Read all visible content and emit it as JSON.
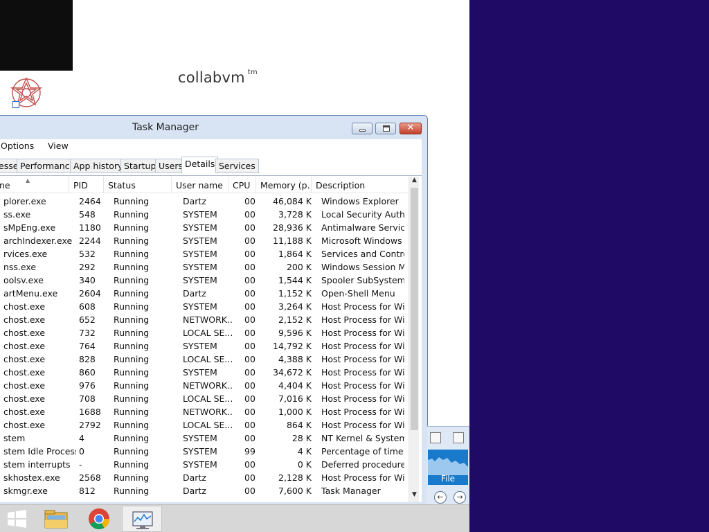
{
  "desktop": {
    "brand": "collabvm",
    "brand_sup": "tm"
  },
  "window": {
    "title": "Task Manager",
    "menu": [
      "Options",
      "View"
    ],
    "tabs": [
      "esses",
      "Performance",
      "App history",
      "Startup",
      "Users",
      "Details",
      "Services"
    ],
    "active_tab": "Details"
  },
  "columns": [
    "ne",
    "PID",
    "Status",
    "User name",
    "CPU",
    "Memory (p...",
    "Description"
  ],
  "rows": [
    {
      "name": "plorer.exe",
      "pid": "2464",
      "status": "Running",
      "user": "Dartz",
      "cpu": "00",
      "mem": "46,084 K",
      "desc": "Windows Explorer"
    },
    {
      "name": "ss.exe",
      "pid": "548",
      "status": "Running",
      "user": "SYSTEM",
      "cpu": "00",
      "mem": "3,728 K",
      "desc": "Local Security Auth..."
    },
    {
      "name": "sMpEng.exe",
      "pid": "1180",
      "status": "Running",
      "user": "SYSTEM",
      "cpu": "00",
      "mem": "28,936 K",
      "desc": "Antimalware Service..."
    },
    {
      "name": "archIndexer.exe",
      "pid": "2244",
      "status": "Running",
      "user": "SYSTEM",
      "cpu": "00",
      "mem": "11,188 K",
      "desc": "Microsoft Windows ..."
    },
    {
      "name": "rvices.exe",
      "pid": "532",
      "status": "Running",
      "user": "SYSTEM",
      "cpu": "00",
      "mem": "1,864 K",
      "desc": "Services and Control..."
    },
    {
      "name": "nss.exe",
      "pid": "292",
      "status": "Running",
      "user": "SYSTEM",
      "cpu": "00",
      "mem": "200 K",
      "desc": "Windows Session M..."
    },
    {
      "name": "oolsv.exe",
      "pid": "340",
      "status": "Running",
      "user": "SYSTEM",
      "cpu": "00",
      "mem": "1,544 K",
      "desc": "Spooler SubSystem ..."
    },
    {
      "name": "artMenu.exe",
      "pid": "2604",
      "status": "Running",
      "user": "Dartz",
      "cpu": "00",
      "mem": "1,152 K",
      "desc": "Open-Shell Menu"
    },
    {
      "name": "chost.exe",
      "pid": "608",
      "status": "Running",
      "user": "SYSTEM",
      "cpu": "00",
      "mem": "3,264 K",
      "desc": "Host Process for Wi..."
    },
    {
      "name": "chost.exe",
      "pid": "652",
      "status": "Running",
      "user": "NETWORK...",
      "cpu": "00",
      "mem": "2,152 K",
      "desc": "Host Process for Wi..."
    },
    {
      "name": "chost.exe",
      "pid": "732",
      "status": "Running",
      "user": "LOCAL SE...",
      "cpu": "00",
      "mem": "9,596 K",
      "desc": "Host Process for Wi..."
    },
    {
      "name": "chost.exe",
      "pid": "764",
      "status": "Running",
      "user": "SYSTEM",
      "cpu": "00",
      "mem": "14,792 K",
      "desc": "Host Process for Wi..."
    },
    {
      "name": "chost.exe",
      "pid": "828",
      "status": "Running",
      "user": "LOCAL SE...",
      "cpu": "00",
      "mem": "4,388 K",
      "desc": "Host Process for Wi..."
    },
    {
      "name": "chost.exe",
      "pid": "860",
      "status": "Running",
      "user": "SYSTEM",
      "cpu": "00",
      "mem": "34,672 K",
      "desc": "Host Process for Wi..."
    },
    {
      "name": "chost.exe",
      "pid": "976",
      "status": "Running",
      "user": "NETWORK...",
      "cpu": "00",
      "mem": "4,404 K",
      "desc": "Host Process for Wi..."
    },
    {
      "name": "chost.exe",
      "pid": "708",
      "status": "Running",
      "user": "LOCAL SE...",
      "cpu": "00",
      "mem": "7,016 K",
      "desc": "Host Process for Wi..."
    },
    {
      "name": "chost.exe",
      "pid": "1688",
      "status": "Running",
      "user": "NETWORK...",
      "cpu": "00",
      "mem": "1,000 K",
      "desc": "Host Process for Wi..."
    },
    {
      "name": "chost.exe",
      "pid": "2792",
      "status": "Running",
      "user": "LOCAL SE...",
      "cpu": "00",
      "mem": "864 K",
      "desc": "Host Process for Wi..."
    },
    {
      "name": "stem",
      "pid": "4",
      "status": "Running",
      "user": "SYSTEM",
      "cpu": "00",
      "mem": "28 K",
      "desc": "NT Kernel & System"
    },
    {
      "name": "stem Idle Process",
      "pid": "0",
      "status": "Running",
      "user": "SYSTEM",
      "cpu": "99",
      "mem": "4 K",
      "desc": "Percentage of time t..."
    },
    {
      "name": "stem interrupts",
      "pid": "-",
      "status": "Running",
      "user": "SYSTEM",
      "cpu": "00",
      "mem": "0 K",
      "desc": "Deferred procedure ..."
    },
    {
      "name": "skhostex.exe",
      "pid": "2568",
      "status": "Running",
      "user": "Dartz",
      "cpu": "00",
      "mem": "2,128 K",
      "desc": "Host Process for Wi..."
    },
    {
      "name": "skmgr.exe",
      "pid": "812",
      "status": "Running",
      "user": "Dartz",
      "cpu": "00",
      "mem": "7,600 K",
      "desc": "Task Manager"
    }
  ],
  "explorer": {
    "file_tab": "File"
  },
  "taskbar": {
    "items": [
      "start-icon",
      "file-explorer-icon",
      "chrome-icon",
      "task-manager-icon"
    ],
    "active": "task-manager-icon"
  }
}
